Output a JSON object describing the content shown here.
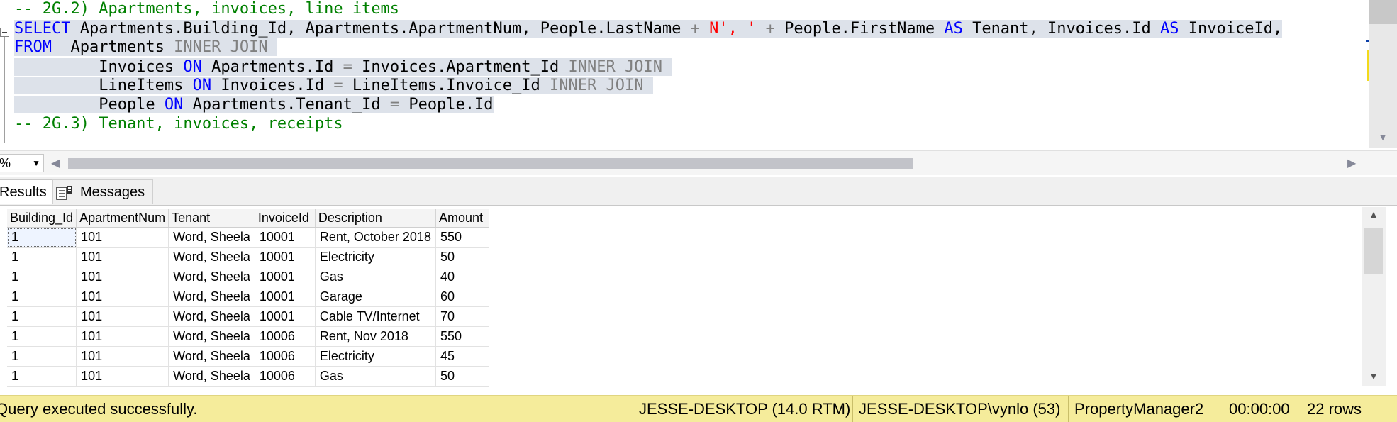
{
  "editor": {
    "lines": [
      {
        "selected": false,
        "tokens": [
          {
            "t": "-- 2G.2) Apartments, invoices, line items",
            "c": "cmt"
          }
        ]
      },
      {
        "selected": true,
        "tokens": [
          {
            "t": "SELECT",
            "c": "kw"
          },
          {
            "t": " Apartments.Building_Id, Apartments.ApartmentNum, People.LastName ",
            "c": "plain"
          },
          {
            "t": "+",
            "c": "op"
          },
          {
            "t": " ",
            "c": "plain"
          },
          {
            "t": "N', '",
            "c": "str"
          },
          {
            "t": " ",
            "c": "plain"
          },
          {
            "t": "+",
            "c": "op"
          },
          {
            "t": " People.FirstName ",
            "c": "plain"
          },
          {
            "t": "AS",
            "c": "kw"
          },
          {
            "t": " Tenant, Invoices.Id ",
            "c": "plain"
          },
          {
            "t": "AS",
            "c": "kw"
          },
          {
            "t": " InvoiceId,",
            "c": "plain"
          }
        ]
      },
      {
        "selected": true,
        "tokens": [
          {
            "t": "FROM",
            "c": "kw"
          },
          {
            "t": "  Apartments ",
            "c": "plain"
          },
          {
            "t": "INNER JOIN ",
            "c": "op"
          }
        ]
      },
      {
        "selected": true,
        "tokens": [
          {
            "t": "         Invoices ",
            "c": "plain"
          },
          {
            "t": "ON",
            "c": "kw"
          },
          {
            "t": " Apartments.Id ",
            "c": "plain"
          },
          {
            "t": "=",
            "c": "op"
          },
          {
            "t": " Invoices.Apartment_Id ",
            "c": "plain"
          },
          {
            "t": "INNER JOIN ",
            "c": "op"
          }
        ]
      },
      {
        "selected": true,
        "tokens": [
          {
            "t": "         LineItems ",
            "c": "plain"
          },
          {
            "t": "ON",
            "c": "kw"
          },
          {
            "t": " Invoices.Id ",
            "c": "plain"
          },
          {
            "t": "=",
            "c": "op"
          },
          {
            "t": " LineItems.Invoice_Id ",
            "c": "plain"
          },
          {
            "t": "INNER JOIN ",
            "c": "op"
          }
        ]
      },
      {
        "selected": true,
        "tokens": [
          {
            "t": "         People ",
            "c": "plain"
          },
          {
            "t": "ON",
            "c": "kw"
          },
          {
            "t": " Apartments.Tenant_Id ",
            "c": "plain"
          },
          {
            "t": "=",
            "c": "op"
          },
          {
            "t": " People.Id",
            "c": "plain"
          }
        ]
      },
      {
        "selected": false,
        "tokens": [
          {
            "t": "-- 2G.3) Tenant, invoices, receipts",
            "c": "cmt"
          }
        ]
      }
    ]
  },
  "zoom": {
    "value": "%",
    "arrow": "▼"
  },
  "hscroll": {
    "left_arrow": "◀",
    "right_arrow": "▶"
  },
  "tabs": {
    "results": "Results",
    "messages": "Messages"
  },
  "grid": {
    "columns": [
      "Building_Id",
      "ApartmentNum",
      "Tenant",
      "InvoiceId",
      "Description",
      "Amount"
    ],
    "rows": [
      [
        "1",
        "101",
        "Word, Sheela",
        "10001",
        "Rent, October 2018",
        "550"
      ],
      [
        "1",
        "101",
        "Word, Sheela",
        "10001",
        "Electricity",
        "50"
      ],
      [
        "1",
        "101",
        "Word, Sheela",
        "10001",
        "Gas",
        "40"
      ],
      [
        "1",
        "101",
        "Word, Sheela",
        "10001",
        "Garage",
        "60"
      ],
      [
        "1",
        "101",
        "Word, Sheela",
        "10001",
        "Cable TV/Internet",
        "70"
      ],
      [
        "1",
        "101",
        "Word, Sheela",
        "10006",
        "Rent, Nov 2018",
        "550"
      ],
      [
        "1",
        "101",
        "Word, Sheela",
        "10006",
        "Electricity",
        "45"
      ],
      [
        "1",
        "101",
        "Word, Sheela",
        "10006",
        "Gas",
        "50"
      ]
    ]
  },
  "status": {
    "message": "Query executed successfully.",
    "server": "JESSE-DESKTOP (14.0 RTM)",
    "login": "JESSE-DESKTOP\\vynlo (53)",
    "database": "PropertyManager2",
    "elapsed": "00:00:00",
    "rows": "22 rows"
  },
  "colors": {
    "keyword": "#0000ff",
    "string": "#ff0000",
    "operator": "#808080",
    "comment": "#008000",
    "selection": "#dde2ea",
    "status_bar": "#f5ec9b"
  }
}
